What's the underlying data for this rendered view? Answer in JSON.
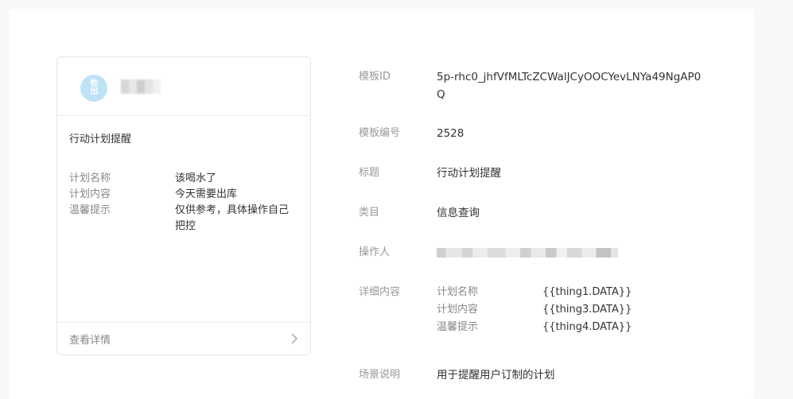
{
  "preview": {
    "avatar_glyph": "牧\n出",
    "title": "行动计划提醒",
    "fields": [
      {
        "label": "计划名称",
        "value": "该喝水了"
      },
      {
        "label": "计划内容",
        "value": "今天需要出库"
      },
      {
        "label": "温馨提示",
        "value": "仅供参考，具体操作自己把控"
      }
    ],
    "footer_link": "查看详情"
  },
  "info": {
    "template_id_label": "模板ID",
    "template_id_value": "5p-rhc0_jhfVfMLTcZCWalJCyOOCYevLNYa49NgAP0Q",
    "template_no_label": "模板编号",
    "template_no_value": "2528",
    "title_label": "标题",
    "title_value": "行动计划提醒",
    "category_label": "类目",
    "category_value": "信息查询",
    "operator_label": "操作人",
    "detail_label": "详细内容",
    "detail_lines": [
      {
        "key": "计划名称",
        "val": "{{thing1.DATA}}"
      },
      {
        "key": "计划内容",
        "val": "{{thing3.DATA}}"
      },
      {
        "key": "温馨提示",
        "val": "{{thing4.DATA}}"
      }
    ],
    "scene_label": "场景说明",
    "scene_value": "用于提醒用户订制的计划"
  }
}
